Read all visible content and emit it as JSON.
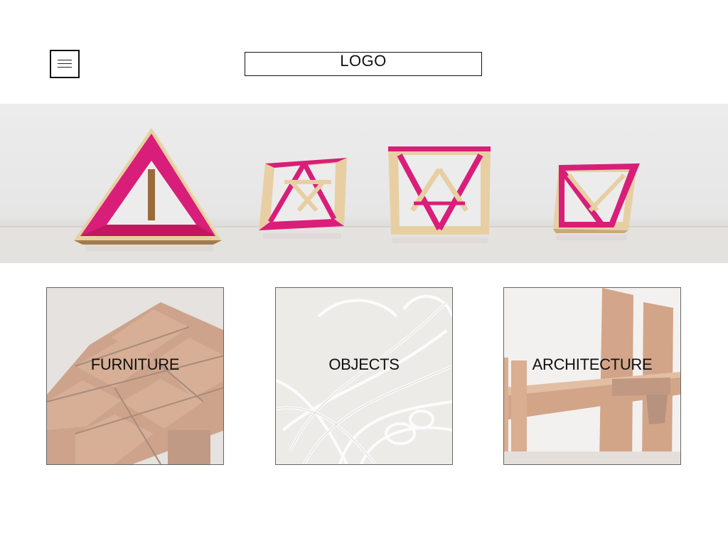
{
  "header": {
    "menu_icon": "hamburger-menu-icon",
    "logo_text": "LOGO"
  },
  "hero": {
    "image": "magenta-and-wood-geometric-sculptures",
    "accent_color": "#d81e79",
    "wood_color": "#e8cfa3"
  },
  "categories": [
    {
      "label": "FURNITURE",
      "image": "wooden-bench-closeup"
    },
    {
      "label": "OBJECTS",
      "image": "white-wire-sculpture"
    },
    {
      "label": "ARCHITECTURE",
      "image": "wooden-frame-structure"
    }
  ]
}
